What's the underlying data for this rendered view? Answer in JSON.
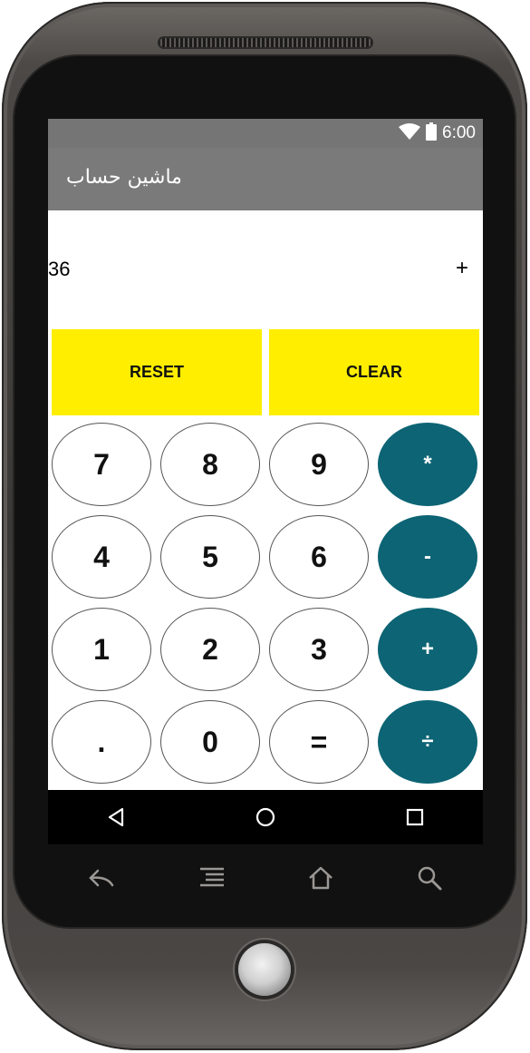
{
  "status_bar": {
    "time": "6:00",
    "icons": [
      "wifi-icon",
      "battery-icon"
    ]
  },
  "app_bar": {
    "title": "ماشین حساب"
  },
  "display": {
    "number": "36",
    "operator": "+"
  },
  "actions": {
    "reset_label": "RESET",
    "clear_label": "CLEAR"
  },
  "keypad": {
    "rows": [
      [
        "7",
        "8",
        "9",
        "*"
      ],
      [
        "4",
        "5",
        "6",
        "-"
      ],
      [
        "1",
        "2",
        "3",
        "+"
      ],
      [
        ".",
        "0",
        "=",
        "÷"
      ]
    ]
  },
  "navigation": {
    "icons": [
      "back-triangle-icon",
      "home-circle-icon",
      "recents-square-icon"
    ]
  },
  "hardware_keys": {
    "icons": [
      "back-arrow-icon",
      "menu-icon",
      "home-icon",
      "search-icon"
    ]
  },
  "colors": {
    "status_bar": "#757575",
    "app_bar": "#7a7a7a",
    "action_button": "#ffee00",
    "operator_key": "#0c6474",
    "number_key": "#ffffff"
  }
}
